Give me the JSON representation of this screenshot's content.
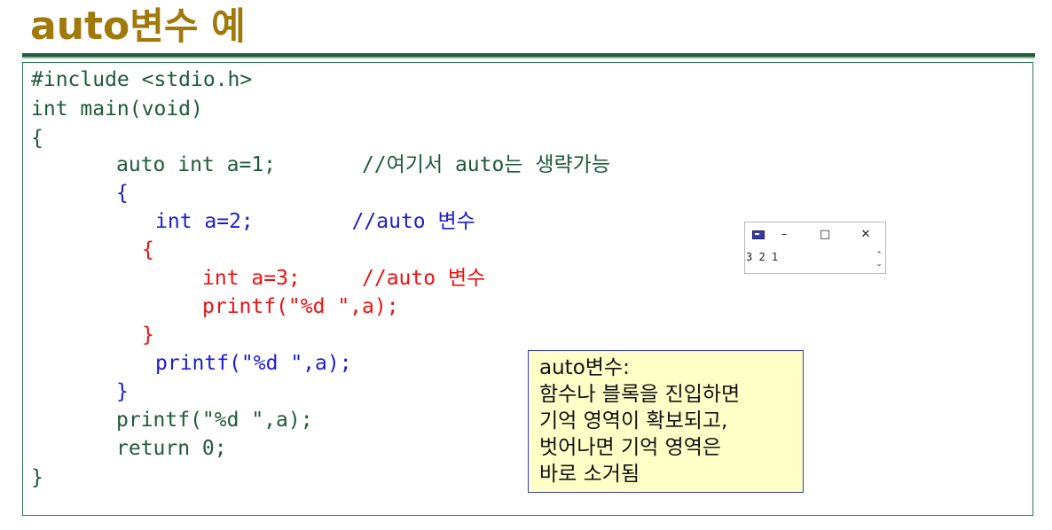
{
  "title": {
    "keyword": "auto",
    "rest": "변수 예"
  },
  "code": {
    "l1": "#include <stdio.h>",
    "l2": "int main(void)",
    "l3": "{",
    "l4": "auto int a=1;       //여기서 auto는 생략가능",
    "l5": "{",
    "l6": "int a=2;        //auto 변수",
    "l7": "{",
    "l8": "int a=3;     //auto 변수",
    "l9": "printf(\"%d \",a);",
    "l10": "}",
    "l11": "printf(\"%d \",a);",
    "l12": "}",
    "l13": "printf(\"%d \",a);",
    "l14": "return 0;",
    "l15": "}"
  },
  "console": {
    "icon": "console-app-icon",
    "minimize": "–",
    "maximize": "□",
    "close": "✕",
    "output": "3 2 1"
  },
  "note": {
    "line1": "auto변수:",
    "line2": "함수나 블록을 진입하면",
    "line3": "기억 영역이 확보되고,",
    "line4": "벗어나면 기억 영역은",
    "line5": "바로 소거됨"
  },
  "colors": {
    "title": "#a0790a",
    "outer_scope": "#1f5a3a",
    "middle_scope": "#1d1dd0",
    "inner_scope": "#ee1010",
    "note_background": "#ffffc8"
  }
}
